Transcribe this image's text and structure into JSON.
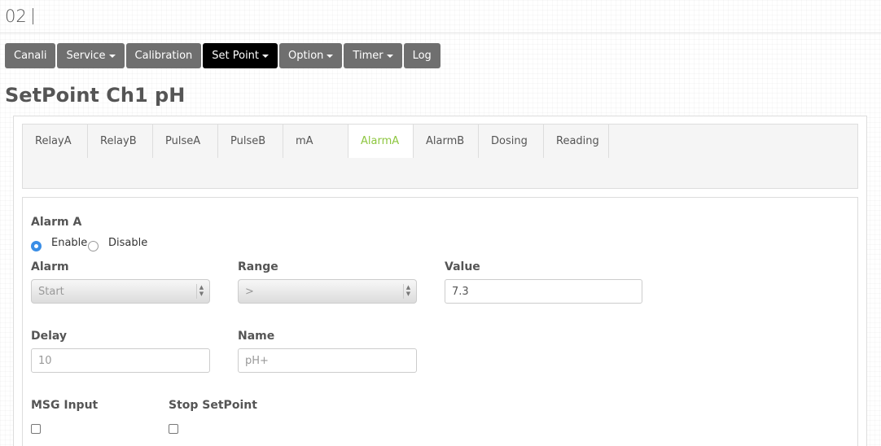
{
  "header": {
    "title": "02"
  },
  "nav": [
    {
      "label": "Canali",
      "dropdown": false,
      "active": false
    },
    {
      "label": "Service",
      "dropdown": true,
      "active": false
    },
    {
      "label": "Calibration",
      "dropdown": false,
      "active": false
    },
    {
      "label": "Set Point",
      "dropdown": true,
      "active": true
    },
    {
      "label": "Option",
      "dropdown": true,
      "active": false
    },
    {
      "label": "Timer",
      "dropdown": true,
      "active": false
    },
    {
      "label": "Log",
      "dropdown": false,
      "active": false
    }
  ],
  "page_title": "SetPoint Ch1 pH",
  "tabs": [
    "RelayA",
    "RelayB",
    "PulseA",
    "PulseB",
    "mA",
    "AlarmA",
    "AlarmB",
    "Dosing",
    "Reading"
  ],
  "active_tab": "AlarmA",
  "accent_color": "#8dc63f",
  "form": {
    "section_title": "Alarm A",
    "enable_label": "Enable",
    "disable_label": "Disable",
    "enabled": true,
    "alarm_label": "Alarm",
    "alarm_value": "Start",
    "range_label": "Range",
    "range_value": ">",
    "value_label": "Value",
    "value_value": "7.3",
    "delay_label": "Delay",
    "delay_value": "10",
    "name_label": "Name",
    "name_value": "pH+",
    "msg_input_label": "MSG Input",
    "stop_setpoint_label": "Stop SetPoint",
    "msg_input_checked": false,
    "stop_setpoint_checked": false
  }
}
